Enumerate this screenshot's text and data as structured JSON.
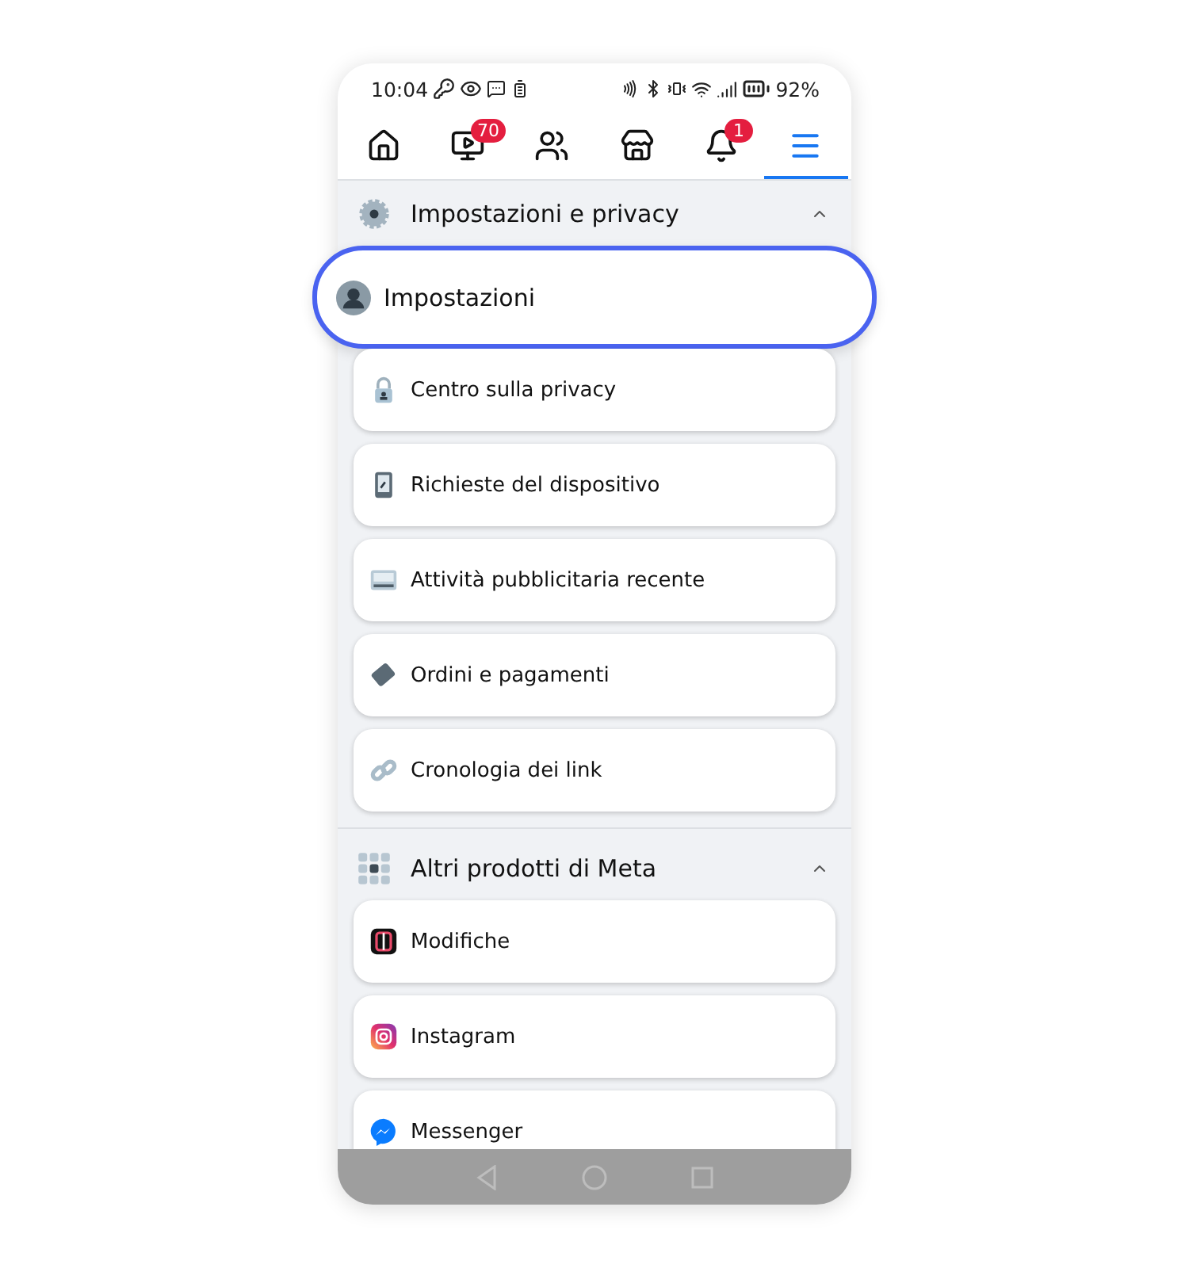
{
  "status_bar": {
    "time": "10:04",
    "battery": "92%"
  },
  "tabs": [
    {
      "kind": "home",
      "selected": false
    },
    {
      "kind": "video",
      "badge": "70",
      "selected": false
    },
    {
      "kind": "friends",
      "selected": false
    },
    {
      "kind": "store",
      "selected": false
    },
    {
      "kind": "bell",
      "badge": "1",
      "selected": false
    },
    {
      "kind": "menu",
      "selected": true
    }
  ],
  "sections": [
    {
      "title": "Impostazioni e privacy",
      "kind": "gear",
      "expanded": true,
      "items": [
        {
          "label": "Impostazioni",
          "kind": "profile",
          "highlighted": true
        },
        {
          "label": "Centro sulla privacy",
          "kind": "lock",
          "highlighted": false
        },
        {
          "label": "Richieste del dispositivo",
          "kind": "phone",
          "highlighted": false
        },
        {
          "label": "Attività pubblicitaria recente",
          "kind": "ad",
          "highlighted": false
        },
        {
          "label": "Ordini e pagamenti",
          "kind": "card",
          "highlighted": false
        },
        {
          "label": "Cronologia dei link",
          "kind": "link",
          "highlighted": false
        }
      ]
    },
    {
      "title": "Altri prodotti di Meta",
      "kind": "grid",
      "expanded": true,
      "items": [
        {
          "label": "Modifiche",
          "kind": "edits",
          "highlighted": false
        },
        {
          "label": "Instagram",
          "kind": "instagram",
          "highlighted": false
        },
        {
          "label": "Messenger",
          "kind": "messenger",
          "highlighted": false
        }
      ]
    }
  ]
}
